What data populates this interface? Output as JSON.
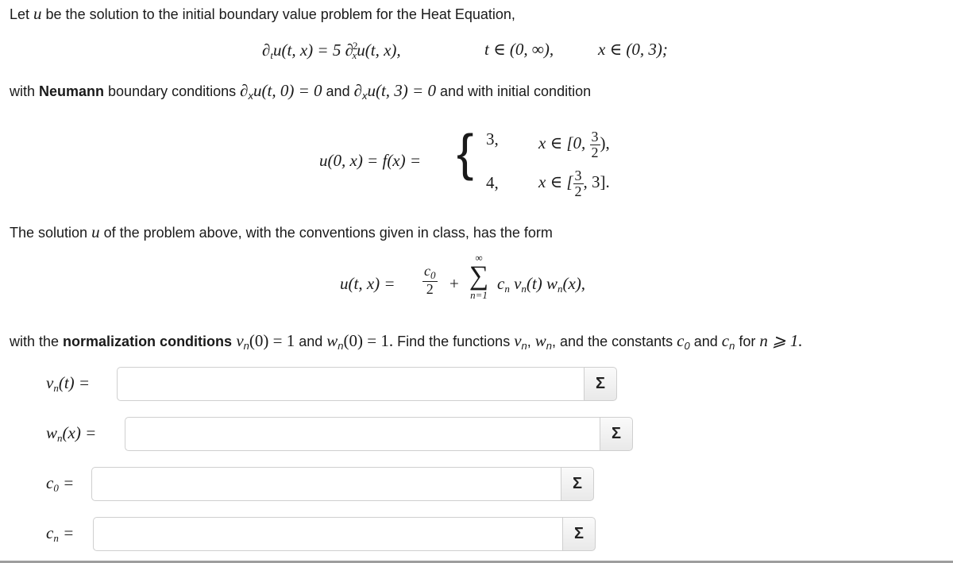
{
  "problem": {
    "intro_before_u": "Let ",
    "intro_var": "u",
    "intro_after_u": " be the solution to the initial boundary value problem for the Heat Equation,",
    "pde_lhs": "∂",
    "pde_lhs_sub": "t",
    "pde_lhs_rest": "u(t, x) = 5 ∂",
    "pde_rhs_sub": "x",
    "pde_rhs_sup": "2",
    "pde_rhs_rest": "u(t, x),",
    "pde_domain_t": "t ∈ (0, ∞),",
    "pde_domain_x": "x ∈ (0, 3);",
    "bc_prefix": "with ",
    "bc_bold": "Neumann",
    "bc_mid": " boundary conditions ",
    "bc_cond1": "∂",
    "bc_cond1_sub": "x",
    "bc_cond1_rest": "u(t, 0) = 0",
    "bc_and": " and ",
    "bc_cond2": "∂",
    "bc_cond2_sub": "x",
    "bc_cond2_rest": "u(t, 3) = 0",
    "bc_suffix": " and with initial condition",
    "ic_lhs": "u(0, x) = f(x) =",
    "ic_case1_value": "3,",
    "ic_case1_domain_prefix": "x ∈ [0,",
    "ic_case1_frac_num": "3",
    "ic_case1_frac_den": "2",
    "ic_case1_domain_suffix": "),",
    "ic_case2_value": "4,",
    "ic_case2_domain_prefix": "x ∈ [",
    "ic_case2_frac_num": "3",
    "ic_case2_frac_den": "2",
    "ic_case2_domain_suffix": ", 3].",
    "solution_text_before": "The solution ",
    "solution_var": "u",
    "solution_text_after": " of the problem above, with the conventions given in class, has the form",
    "series_lhs": "u(t, x) =",
    "series_frac_num": "c",
    "series_frac_num_sub": "0",
    "series_frac_den": "2",
    "series_plus": "+",
    "series_sigma": "∑",
    "series_sigma_top": "∞",
    "series_sigma_bottom": "n=1",
    "series_term": "c",
    "series_term_sub": "n",
    "series_term_v": "v",
    "series_term_v_sub": "n",
    "series_term_v_arg": "(t)",
    "series_term_w": "w",
    "series_term_w_sub": "n",
    "series_term_w_arg": "(x),",
    "norm_prefix": "with the ",
    "norm_bold": "normalization conditions",
    "norm_cond1": " v",
    "norm_cond1_sub": "n",
    "norm_cond1_rest": "(0) = 1",
    "norm_and": " and ",
    "norm_cond2": "w",
    "norm_cond2_sub": "n",
    "norm_cond2_rest": "(0) = 1.",
    "norm_find": " Find the functions ",
    "norm_v": "v",
    "norm_v_sub": "n",
    "norm_comma": ", ",
    "norm_w": "w",
    "norm_w_sub": "n",
    "norm_and_const": ", and the constants ",
    "norm_c0": "c",
    "norm_c0_sub": "0",
    "norm_and2": " and ",
    "norm_cn": "c",
    "norm_cn_sub": "n",
    "norm_for": " for ",
    "norm_cond": "n ⩾ 1."
  },
  "answers": [
    {
      "label_main": "v",
      "label_sub": "n",
      "label_rest": "(t) =",
      "value": "",
      "placeholder": "",
      "button_icon": "Σ"
    },
    {
      "label_main": "w",
      "label_sub": "n",
      "label_rest": "(x) =",
      "value": "",
      "placeholder": "",
      "button_icon": "Σ"
    },
    {
      "label_main": "c",
      "label_sub": "0",
      "label_rest": " =",
      "value": "",
      "placeholder": "",
      "button_icon": "Σ"
    },
    {
      "label_main": "c",
      "label_sub": "n",
      "label_rest": " =",
      "value": "",
      "placeholder": "",
      "button_icon": "Σ"
    }
  ]
}
